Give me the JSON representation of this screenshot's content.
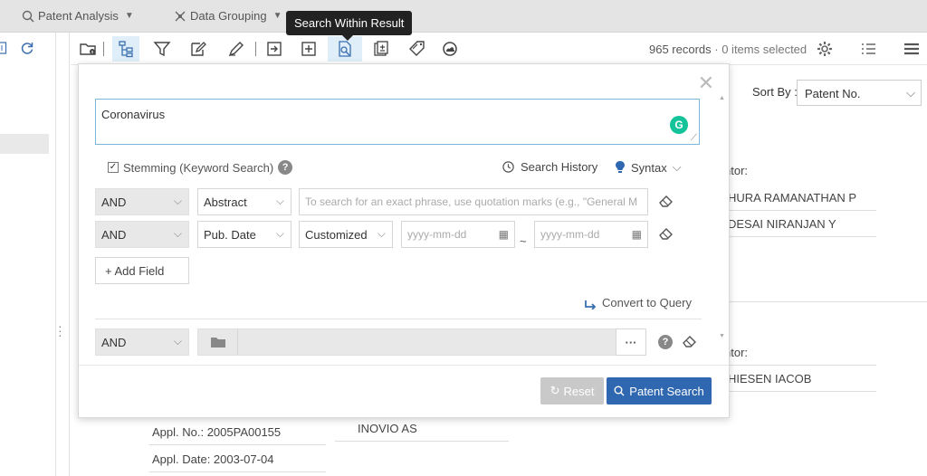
{
  "topbar": {
    "menus": [
      {
        "icon": "analysis-icon",
        "label": "Patent Analysis"
      },
      {
        "icon": "data-grouping-icon",
        "label": "Data Grouping"
      }
    ]
  },
  "tooltip": "Search Within Result",
  "toolbar": {
    "icons": [
      "folder-info-icon",
      "tree-icon",
      "filter-icon",
      "edit-note-icon",
      "pen-icon",
      "export-icon",
      "add-icon",
      "search-within-result-icon",
      "compare-icon",
      "tag-icon",
      "cloud-icon"
    ],
    "records_count": "965 records",
    "selected_text": " · 0 items selected"
  },
  "background": {
    "sort_by_label": "Sort By :",
    "sort_by_value": "Patent No.",
    "inventor_label_1": "ntor:",
    "inventor_1a": "HURA RAMANATHAN P",
    "inventor_1b": "DESAI NIRANJAN Y",
    "inventor_label_2": "ntor:",
    "inventor_2a": "HIESEN IACOB",
    "assignee": "INOVIO AS",
    "appl_no": "Appl. No.: 2005PA00155",
    "appl_date": "Appl. Date: 2003-07-04"
  },
  "modal": {
    "keyword_value": "Coronavirus",
    "grammarly_letter": "G",
    "stemming_label": "Stemming (Keyword Search)",
    "stemming_checked": "✓",
    "help": "?",
    "search_history": "Search History",
    "syntax": "Syntax",
    "row1": {
      "operator": "AND",
      "field": "Abstract",
      "placeholder": "To search for an exact phrase, use quotation marks (e.g., \"General M"
    },
    "row2": {
      "operator": "AND",
      "field": "Pub. Date",
      "mode": "Customized",
      "from_placeholder": "yyyy-mm-dd",
      "to_placeholder": "yyyy-mm-dd",
      "separator": "~"
    },
    "add_field": "+ Add Field",
    "convert_to_query": "Convert to Query",
    "row3": {
      "operator": "AND",
      "more": "···"
    },
    "reset": "Reset",
    "patent_search": "Patent Search"
  },
  "colors": {
    "accent": "#2f67b0",
    "tooltip_bg": "#222222",
    "grammarly": "#15c39a"
  }
}
